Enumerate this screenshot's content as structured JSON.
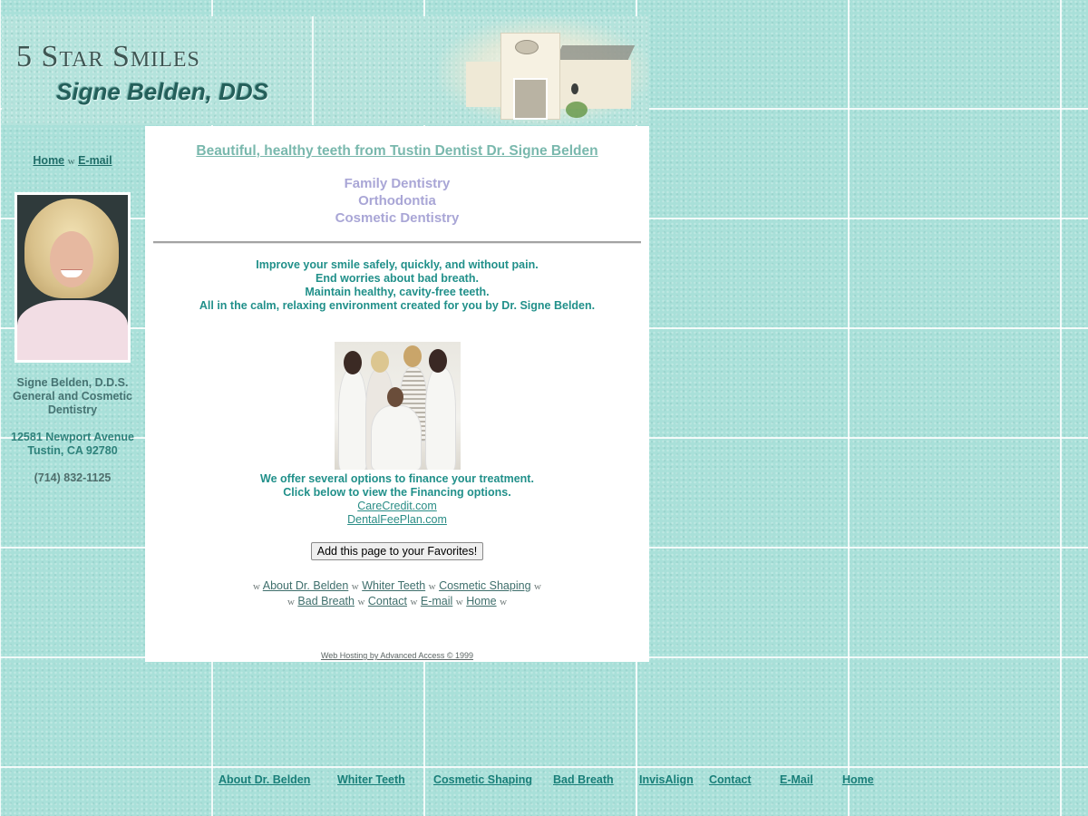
{
  "header": {
    "logo_title": "5 Star Smiles",
    "logo_subtitle": "Signe Belden, DDS",
    "building_image_alt": "dental-office-building"
  },
  "sidebar": {
    "links": [
      {
        "label": "Home"
      },
      {
        "label": "E-mail"
      }
    ],
    "separator": "w",
    "portrait_alt": "Dr. Signe Belden portrait",
    "name": "Signe Belden, D.D.S.",
    "specialty_line1": "General and Cosmetic",
    "specialty_line2": "Dentistry",
    "address_line1": "12581 Newport Avenue",
    "address_line2": "Tustin, CA 92780",
    "phone": "(714) 832-1125"
  },
  "main": {
    "title": "Beautiful, healthy teeth from Tustin Dentist Dr. Signe Belden",
    "services": [
      "Family Dentistry",
      "Orthodontia",
      "Cosmetic Dentistry"
    ],
    "benefits": [
      "Improve your smile safely, quickly, and without pain.",
      "End worries about bad breath.",
      "Maintain healthy, cavity-free teeth.",
      "All in the calm, relaxing environment created for you by Dr. Signe Belden."
    ],
    "team_photo_alt": "Dental team photo",
    "finance_line1": "We offer several options to finance your treatment.",
    "finance_line2": "Click below to view the Financing options.",
    "finance_links": [
      "CareCredit.com",
      "DentalFeePlan.com"
    ],
    "favorites_button": "Add this page to your Favorites!",
    "bottom_links_row1": [
      "About Dr. Belden",
      "Whiter Teeth",
      "Cosmetic Shaping"
    ],
    "bottom_links_row2": [
      "Bad Breath",
      "Contact",
      "E-mail",
      "Home"
    ],
    "separator": "w",
    "hosting": "Web Hosting by Advanced Access © 1999"
  },
  "footer_nav": [
    "About Dr. Belden",
    "Whiter Teeth",
    "Cosmetic Shaping",
    "Bad Breath",
    "InvisAlign",
    "Contact",
    "E-Mail",
    "Home"
  ],
  "colors": {
    "background_tile": "#a9e0d9",
    "accent_teal": "#21908a",
    "services_lavender": "#a9a6d6",
    "title_link": "#79b8ad"
  }
}
